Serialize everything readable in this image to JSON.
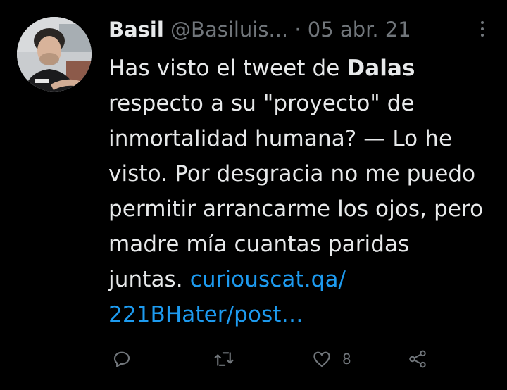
{
  "tweet": {
    "author_name": "Basil",
    "author_handle": "@Basiluis...",
    "separator": "·",
    "date": "05 abr. 21",
    "text_part1": "Has visto el tweet de ",
    "text_bold": "Dalas",
    "text_part2": " respecto a su \"proyecto\" de inmortalidad humana? — Lo he visto. Por desgracia no me puedo permitir arrancarme los ojos, pero madre mía cuantas paridas juntas. ",
    "link_text": "curiouscat.qa/\n221BHater/post…",
    "like_count": "8"
  },
  "icons": {
    "reply": "reply-icon",
    "retweet": "retweet-icon",
    "like": "heart-icon",
    "share": "share-icon",
    "more": "more-vertical-icon"
  },
  "colors": {
    "background": "#000000",
    "text": "#e7e9ea",
    "secondary": "#71767b",
    "link": "#1d9bf0"
  }
}
